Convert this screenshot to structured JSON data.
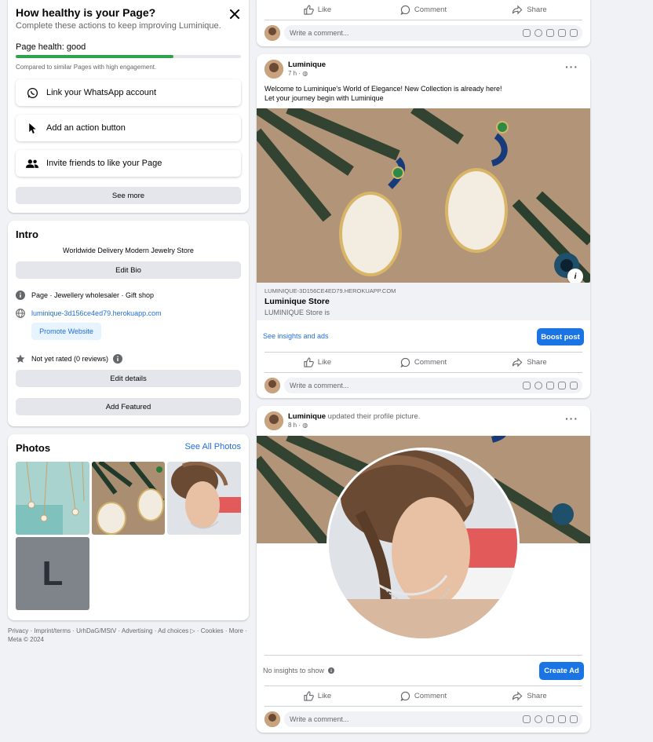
{
  "health": {
    "title": "How healthy is your Page?",
    "subtitle_prefix": "Complete these actions to keep improving ",
    "page_name": "Luminique.",
    "health_label": "Page health: good",
    "health_progress_pct": 70,
    "compare_text": "Compared to similar Pages with high engagement.",
    "actions": [
      {
        "label": "Link your WhatsApp account",
        "icon": "whatsapp-icon"
      },
      {
        "label": "Add an action button",
        "icon": "cursor-icon"
      },
      {
        "label": "Invite friends to like your Page",
        "icon": "people-icon"
      }
    ],
    "see_more": "See more"
  },
  "intro": {
    "title": "Intro",
    "bio": "Worldwide Delivery Modern Jewelry Store",
    "edit_bio": "Edit Bio",
    "category": "Page · Jewellery wholesaler · Gift shop",
    "website": "luminique-3d156ce4ed79.herokuapp.com",
    "promote": "Promote Website",
    "rating": "Not yet rated (0 reviews)",
    "edit_details": "Edit details",
    "add_featured": "Add Featured"
  },
  "photos": {
    "title": "Photos",
    "see_all": "See All Photos",
    "letter": "L"
  },
  "footer": {
    "links": "Privacy · Imprint/terms · UrhDaG/MStV · Advertising · Ad choices ▷ · Cookies · More ·",
    "copyright": "Meta © 2024"
  },
  "actions": {
    "like": "Like",
    "comment": "Comment",
    "share": "Share"
  },
  "comment_placeholder": "Write a comment...",
  "post1": {
    "author": "Luminique",
    "time": "7 h ·",
    "text_line1": "Welcome to Luminique's World of Elegance! New Collection is already here!",
    "text_line2": "Let your journey begin with Luminique",
    "link_domain": "LUMINIQUE-3D156CE4ED79.HEROKUAPP.COM",
    "link_title": "Luminique Store",
    "link_desc": "LUMINIQUE Store is",
    "insights": "See insights and ads",
    "boost": "Boost post",
    "info_glyph": "i"
  },
  "post2": {
    "author": "Luminique",
    "action": " updated their profile picture.",
    "time": "8 h ·",
    "insights": "No insights to show",
    "create_ad": "Create Ad"
  },
  "colors": {
    "accent": "#1b74e4",
    "health_bar": "#31a24c",
    "link": "#216fdb"
  }
}
